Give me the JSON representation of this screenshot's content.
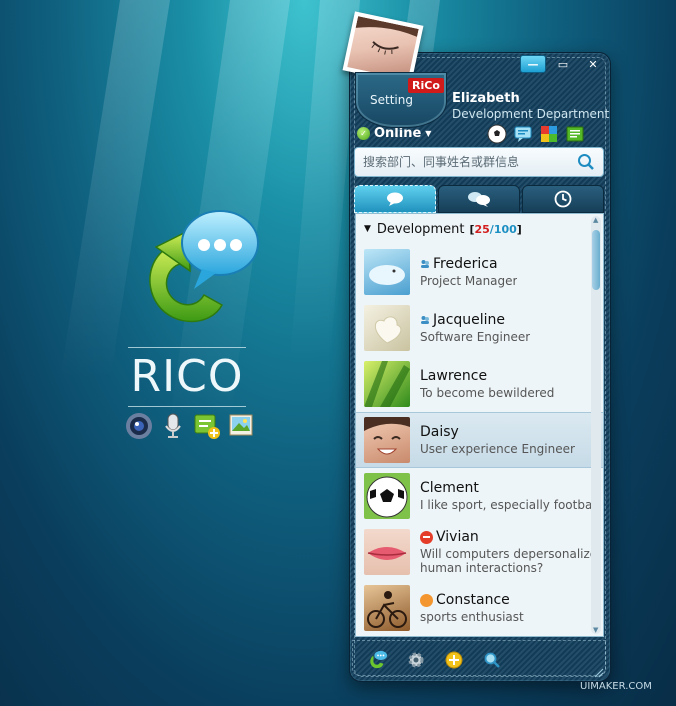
{
  "brand": {
    "name": "RICO",
    "tools": [
      "camera-icon",
      "microphone-icon",
      "add-note-icon",
      "picture-icon"
    ]
  },
  "window": {
    "pocket_label": "Setting",
    "rico_tag": "RiCo",
    "buttons": {
      "minimize": "—",
      "maximize": "▭",
      "close": "✕"
    },
    "user": {
      "name": "Elizabeth",
      "department": "Development Department"
    },
    "status": {
      "label": "Online",
      "color": "#5cb82a"
    },
    "toolbar_icons": [
      "football-icon",
      "chat-icon",
      "color-palette-icon",
      "contacts-card-icon"
    ],
    "search": {
      "placeholder": "搜索部门、同事姓名或群信息"
    },
    "tabs": [
      "single-chat-icon",
      "group-chat-icon",
      "history-clock-icon"
    ]
  },
  "contacts": {
    "group": {
      "name": "Development",
      "online": "25",
      "slash": "/",
      "total": "100"
    },
    "items": [
      {
        "name": "Frederica",
        "note": "Project Manager",
        "status": "group-member"
      },
      {
        "name": "Jacqueline",
        "note": "Software Engineer",
        "status": "group-member"
      },
      {
        "name": "Lawrence",
        "note": "To become bewildered",
        "status": "none"
      },
      {
        "name": "Daisy",
        "note": "User experience Engineer",
        "status": "selected"
      },
      {
        "name": "Clement",
        "note": "I like sport, especially football",
        "status": "none"
      },
      {
        "name": "Vivian",
        "note": "Will computers depersonalize",
        "note2": "human interactions?",
        "status": "busy"
      },
      {
        "name": "Constance",
        "note": "sports enthusiast",
        "status": "away"
      }
    ]
  },
  "bottom_bar": [
    "chat-history-icon",
    "settings-icon",
    "add-icon",
    "find-icon"
  ],
  "watermark": "UIMAKER.COM",
  "colors": {
    "accent": "#1c8fc2",
    "online_count": "#d32020",
    "background": "#0f5f7e"
  }
}
